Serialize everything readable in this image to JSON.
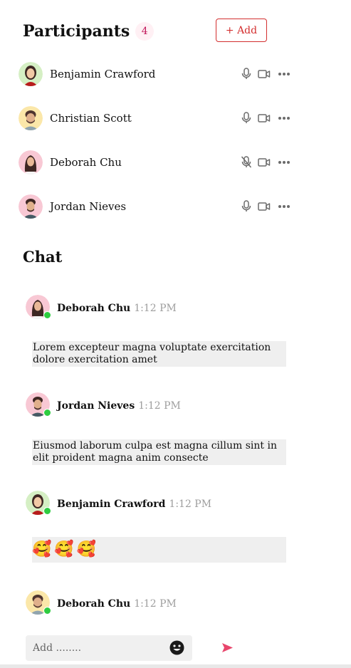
{
  "header": {
    "title": "Participants",
    "count": "4",
    "add_label": "+ Add"
  },
  "participants": [
    {
      "name": "Benjamin Crawford",
      "muted": false
    },
    {
      "name": "Christian Scott",
      "muted": false
    },
    {
      "name": "Deborah Chu",
      "muted": true
    },
    {
      "name": "Jordan Nieves",
      "muted": false
    }
  ],
  "chat": {
    "title": "Chat",
    "messages": [
      {
        "author": "Deborah Chu",
        "time": "1:12 PM",
        "text": "Lorem excepteur magna voluptate exercitation dolore exercitation amet"
      },
      {
        "author": "Jordan Nieves",
        "time": "1:12 PM",
        "text": "Eiusmod laborum culpa est magna cillum sint in elit proident magna anim consecte"
      },
      {
        "author": "Benjamin Crawford",
        "time": "1:12 PM",
        "emojis": [
          "🥰",
          "🥰",
          "🥰"
        ]
      },
      {
        "author": "Deborah Chu",
        "time": "1:12 PM"
      }
    ]
  },
  "composer": {
    "placeholder": "Add ........"
  },
  "colors": {
    "accent": "#d32f2f",
    "send": "#e8466c",
    "online": "#2ecc40",
    "badge_bg": "#fff0f4"
  },
  "icons": [
    "microphone-icon",
    "microphone-off-icon",
    "video-camera-icon",
    "more-options-icon",
    "emoji-icon",
    "send-icon"
  ]
}
